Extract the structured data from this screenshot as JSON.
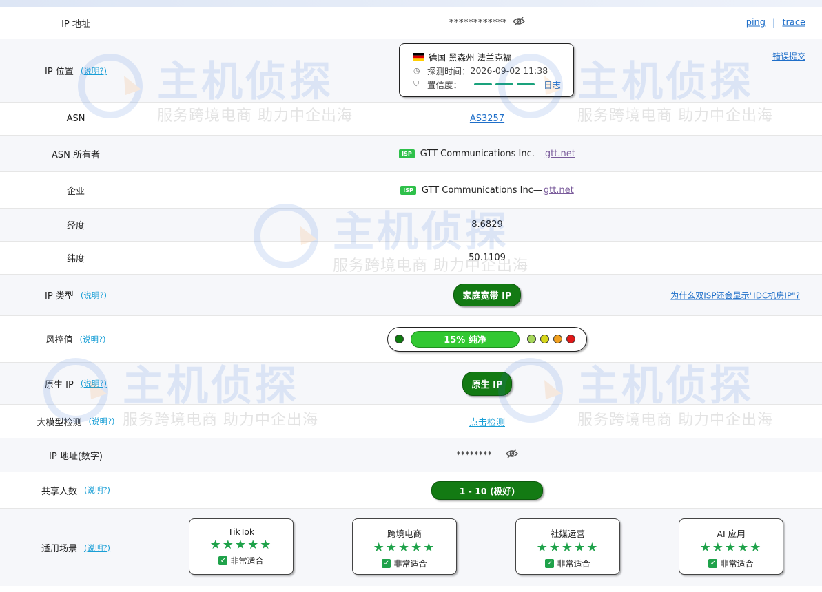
{
  "rows": {
    "ip": {
      "label": "IP 地址",
      "value": "************",
      "ping": "ping",
      "sep": "|",
      "trace": "trace"
    },
    "location": {
      "label": "IP 位置",
      "help": "(说明?)",
      "place": "德国 黑森州 法兰克福",
      "probe_label": "探测时间：",
      "probe_time": "2026-09-02 11:38",
      "confidence_label": "置信度：",
      "log": "日志",
      "report": "错误提交"
    },
    "asn": {
      "label": "ASN",
      "value": "AS3257"
    },
    "asn_owner": {
      "label": "ASN 所有者",
      "badge": "ISP",
      "name": "GTT Communications Inc.—",
      "domain": "gtt.net"
    },
    "company": {
      "label": "企业",
      "badge": "ISP",
      "name": "GTT Communications Inc—",
      "domain": "gtt.net"
    },
    "longitude": {
      "label": "经度",
      "value": "8.6829"
    },
    "latitude": {
      "label": "纬度",
      "value": "50.1109"
    },
    "ip_type": {
      "label": "IP 类型",
      "help": "(说明?)",
      "value": "家庭宽带 IP",
      "note": "为什么双ISP还会显示\"IDC机房IP\"?"
    },
    "risk": {
      "label": "风控值",
      "help": "(说明?)",
      "value": "15%  纯净"
    },
    "native": {
      "label": "原生 IP",
      "help": "(说明?)",
      "value": "原生 IP"
    },
    "llm": {
      "label": "大模型检测",
      "help": "(说明?)",
      "value": "点击检测"
    },
    "ip_number": {
      "label": "IP 地址(数字)",
      "value": "********"
    },
    "shared": {
      "label": "共享人数",
      "help": "(说明?)",
      "value": "1 - 10 (极好)"
    },
    "scenes": {
      "label": "适用场景",
      "help": "(说明?)",
      "cards": [
        {
          "title": "TikTok",
          "stars": "★★★★★",
          "status": "非常适合"
        },
        {
          "title": "跨境电商",
          "stars": "★★★★★",
          "status": "非常适合"
        },
        {
          "title": "社媒运营",
          "stars": "★★★★★",
          "status": "非常适合"
        },
        {
          "title": "AI 应用",
          "stars": "★★★★★",
          "status": "非常适合"
        }
      ]
    }
  },
  "watermark": {
    "brand": "主机侦探",
    "slogan": "服务跨境电商 助力中企出海"
  },
  "colors": {
    "accent_green": "#137a13",
    "risk_green": "#32c832",
    "link_blue": "#1f6fc9",
    "help_blue": "#1a9fd6",
    "star_green": "#1fa24a",
    "confidence_bar": "#1aa27c"
  },
  "risk_dots": [
    "#0e7a0e",
    "#a5d65a",
    "#d6d61a",
    "#f0a020",
    "#e01818"
  ]
}
